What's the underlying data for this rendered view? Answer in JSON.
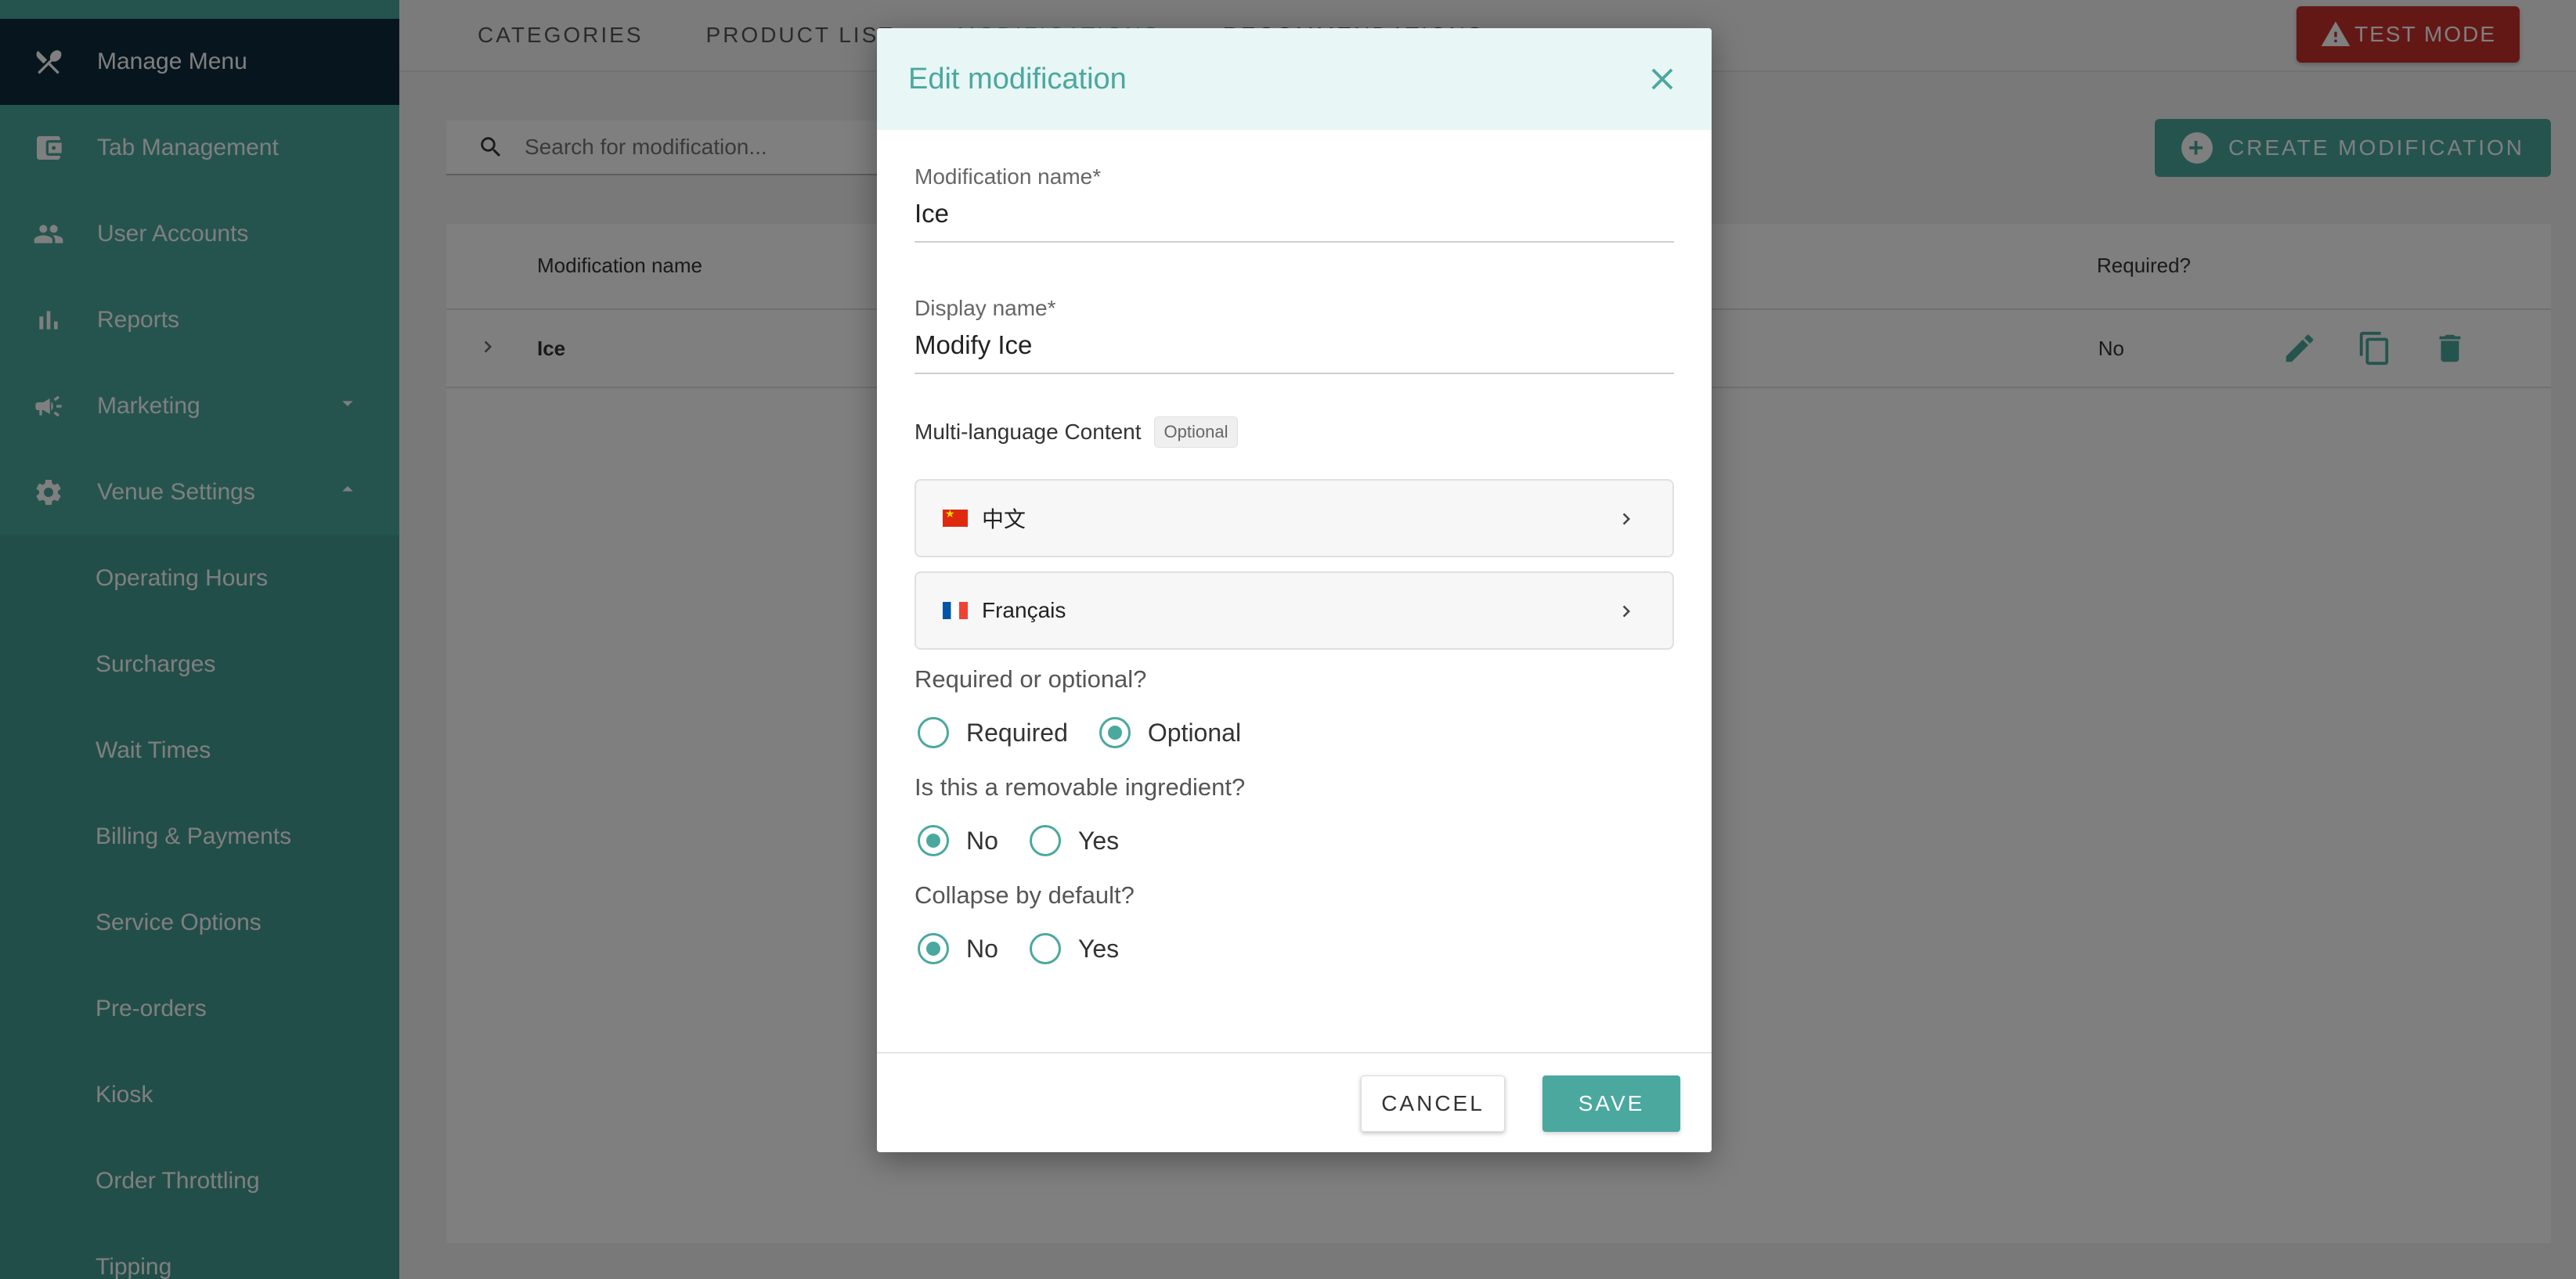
{
  "colors": {
    "accent": "#4aa89f",
    "sidebar_dark": "#0f2b3c",
    "test_mode": "#c9302c"
  },
  "sidebar": {
    "header": {
      "label": "Manage Menu",
      "icon": "utensils-icon"
    },
    "items": [
      {
        "label": "Tab Management",
        "icon": "wallet-icon"
      },
      {
        "label": "User Accounts",
        "icon": "people-icon"
      },
      {
        "label": "Reports",
        "icon": "bar-chart-icon"
      },
      {
        "label": "Marketing",
        "icon": "megaphone-icon"
      },
      {
        "label": "Venue Settings",
        "icon": "gear-icon"
      }
    ],
    "sub_items": [
      "Operating Hours",
      "Surcharges",
      "Wait Times",
      "Billing & Payments",
      "Service Options",
      "Pre-orders",
      "Kiosk",
      "Order Throttling",
      "Tipping"
    ]
  },
  "topbar": {
    "tabs": [
      "CATEGORIES",
      "PRODUCT LIST",
      "MODIFICATIONS",
      "RECOMMENDATIONS"
    ],
    "test_mode_label": "TEST MODE"
  },
  "search": {
    "placeholder": "Search for modification..."
  },
  "create_button_label": "CREATE MODIFICATION",
  "table": {
    "columns": [
      "Modification name",
      "Required?"
    ],
    "rows": [
      {
        "name": "Ice",
        "required": "No"
      }
    ]
  },
  "dialog": {
    "title": "Edit modification",
    "name_label": "Modification name*",
    "name_value": "Ice",
    "display_label": "Display name*",
    "display_value": "Modify Ice",
    "multilang_title": "Multi-language Content",
    "optional_badge": "Optional",
    "languages": [
      "中文",
      "Français"
    ],
    "required_question": "Required or optional?",
    "required_options": [
      "Required",
      "Optional"
    ],
    "required_selected": "Optional",
    "removable_question": "Is this a removable ingredient?",
    "removable_options": [
      "No",
      "Yes"
    ],
    "removable_selected": "No",
    "collapse_question": "Collapse by default?",
    "collapse_options": [
      "No",
      "Yes"
    ],
    "collapse_selected": "No",
    "cancel_label": "CANCEL",
    "save_label": "SAVE"
  }
}
